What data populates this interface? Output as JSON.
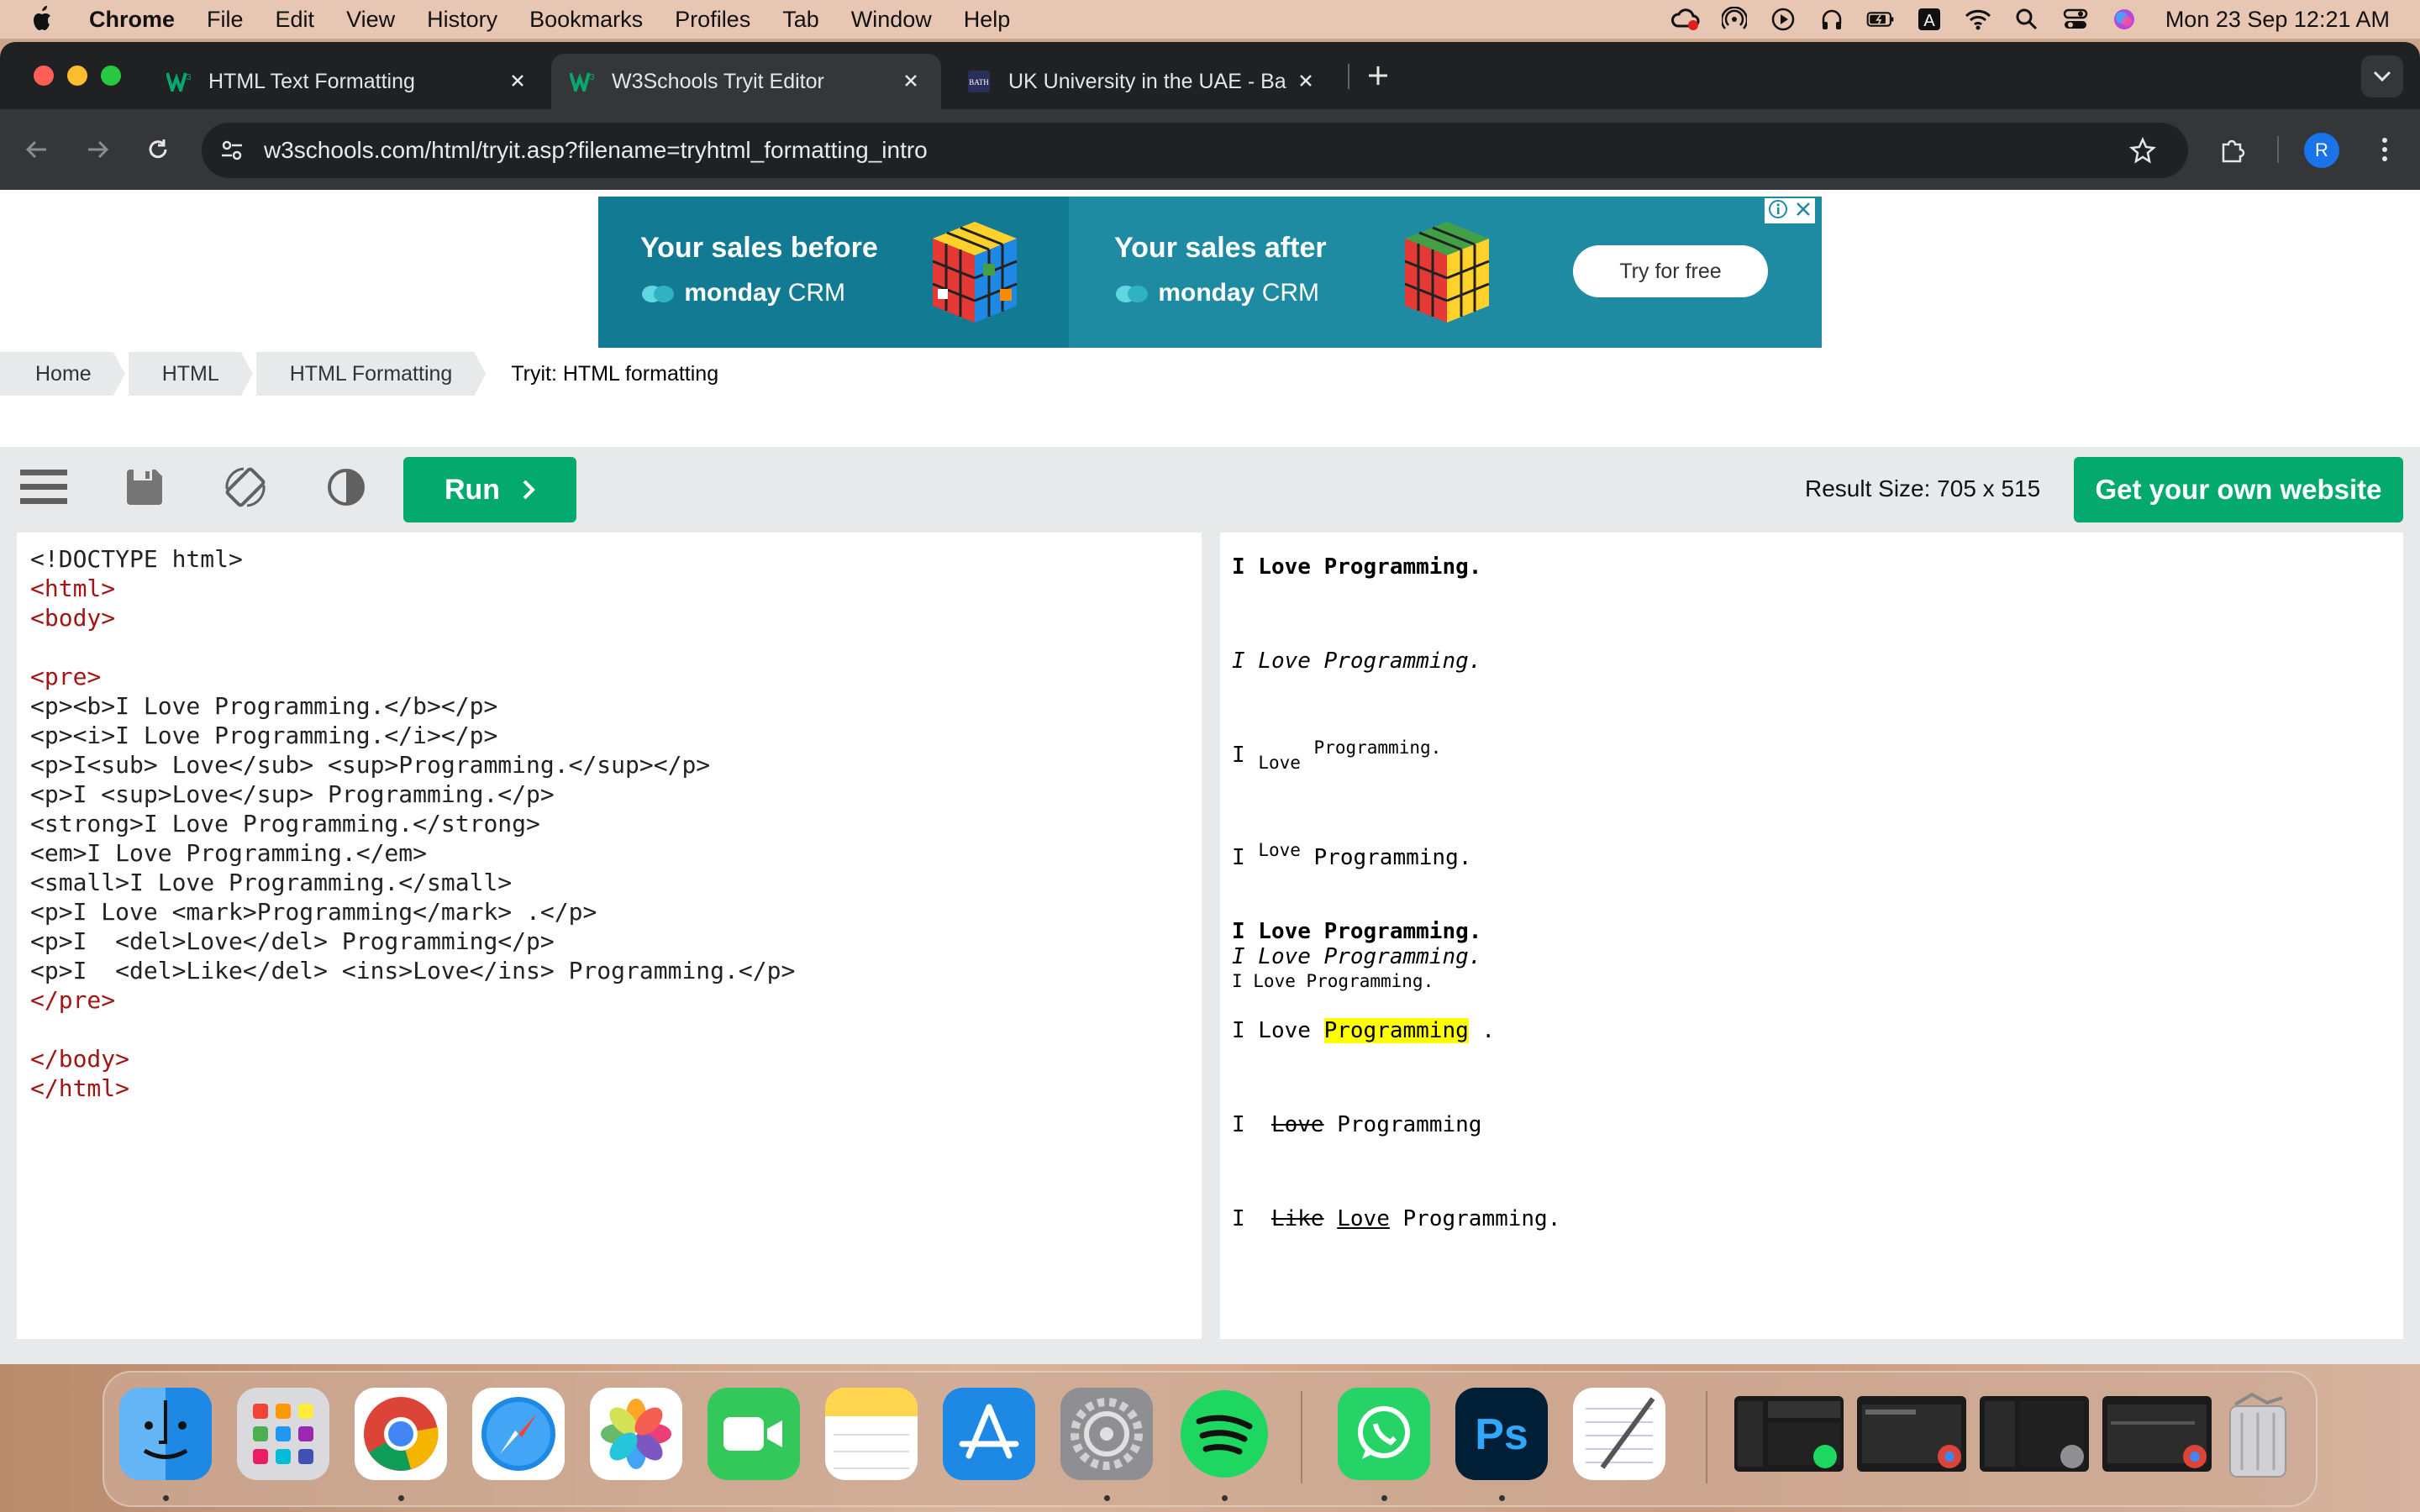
{
  "menubar": {
    "app": "Chrome",
    "items": [
      "File",
      "Edit",
      "View",
      "History",
      "Bookmarks",
      "Profiles",
      "Tab",
      "Window",
      "Help"
    ],
    "input_badge": "A",
    "clock": "Mon 23 Sep  12:21 AM"
  },
  "browser": {
    "tabs": [
      {
        "title": "HTML Text Formatting",
        "favicon": "w3schools-icon"
      },
      {
        "title": "W3Schools Tryit Editor",
        "favicon": "w3schools-icon",
        "active": true
      },
      {
        "title": "UK University in the UAE - Ba",
        "favicon": "university-icon"
      }
    ],
    "url": "w3schools.com/html/tryit.asp?filename=tryhtml_formatting_intro",
    "profile_initial": "R"
  },
  "ad": {
    "before": "Your sales before",
    "after": "Your sales after",
    "brand": "monday",
    "brand_suffix": "CRM",
    "cta": "Try for free"
  },
  "breadcrumb": [
    "Home",
    "HTML",
    "HTML Formatting"
  ],
  "breadcrumb_current": "Tryit: HTML formatting",
  "tools": {
    "run_label": "Run",
    "result_size": "Result Size: 705 x 515",
    "get_site": "Get your own website"
  },
  "code_lines": [
    "<!DOCTYPE html>",
    "<html>",
    "<body>",
    "",
    "<pre>",
    "<p><b>I Love Programming.</b></p>",
    "<p><i>I Love Programming.</i></p>",
    "<p>I<sub> Love</sub> <sup>Programming.</sup></p>",
    "<p>I <sup>Love</sup> Programming.</p>",
    "<strong>I Love Programming.</strong>",
    "<em>I Love Programming.</em>",
    "<small>I Love Programming.</small>",
    "<p>I Love <mark>Programming</mark> .</p>",
    "<p>I  <del>Love</del> Programming</p>",
    "<p>I  <del>Like</del> <ins>Love</ins> Programming.</p>",
    "</pre>",
    "",
    "</body>",
    "</html>"
  ],
  "result": {
    "bold": "I Love Programming.",
    "italic": "I Love Programming.",
    "sub_i": "I ",
    "sub_love": "Love",
    "sub_prog": "Programming.",
    "sup_i": "I ",
    "sup_love": "Love",
    "sup_prog": " Programming.",
    "strong": "I Love Programming.",
    "em": "I Love Programming.",
    "small": "I Love Programming.",
    "mark_pre": "I Love ",
    "mark_word": "Programming",
    "mark_post": " .",
    "del_i": "I  ",
    "del_word": "Love",
    "del_post": " Programming",
    "ins_i": "I  ",
    "ins_del": "Like",
    "ins_word": "Love",
    "ins_post": " Programming."
  },
  "dock_apps": [
    "Finder",
    "Launchpad",
    "Google Chrome",
    "Safari",
    "Photos",
    "FaceTime",
    "Notes",
    "App Store",
    "System Settings",
    "Spotify",
    "WhatsApp",
    "Photoshop",
    "TextEdit"
  ]
}
